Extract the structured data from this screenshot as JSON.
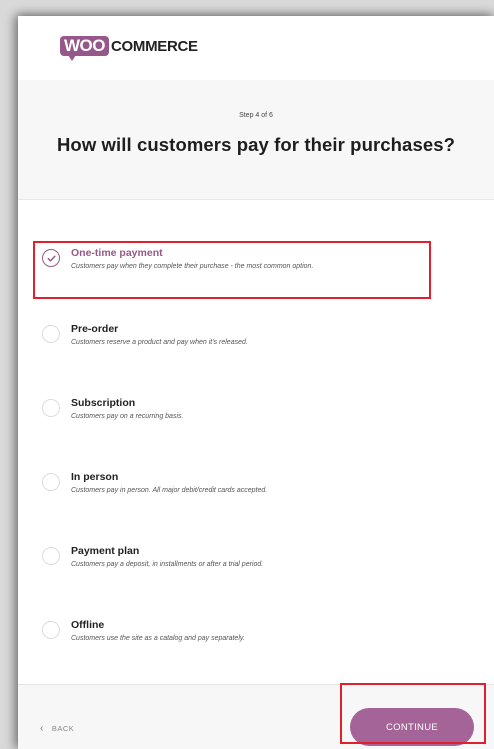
{
  "logo": {
    "woo": "WOO",
    "commerce": "COMMERCE"
  },
  "header": {
    "step": "Step 4 of 6",
    "question": "How will customers pay for their purchases?"
  },
  "options": [
    {
      "title": "One-time payment",
      "description": "Customers pay when they complete their purchase - the most common option.",
      "selected": true
    },
    {
      "title": "Pre-order",
      "description": "Customers reserve a product and pay when it's released.",
      "selected": false
    },
    {
      "title": "Subscription",
      "description": "Customers pay on a recurring basis.",
      "selected": false
    },
    {
      "title": "In person",
      "description": "Customers pay in person. All major debit/credit cards accepted.",
      "selected": false
    },
    {
      "title": "Payment plan",
      "description": "Customers pay a deposit, in installments or after a trial period.",
      "selected": false
    },
    {
      "title": "Offline",
      "description": "Customers use the site as a catalog and pay separately.",
      "selected": false
    }
  ],
  "footer": {
    "back_icon": "chevron-left-icon",
    "back_label": "BACK",
    "continue_label": "CONTINUE"
  },
  "colors": {
    "brand": "#96588a",
    "button": "#a46497",
    "annotation": "#e0212d"
  }
}
